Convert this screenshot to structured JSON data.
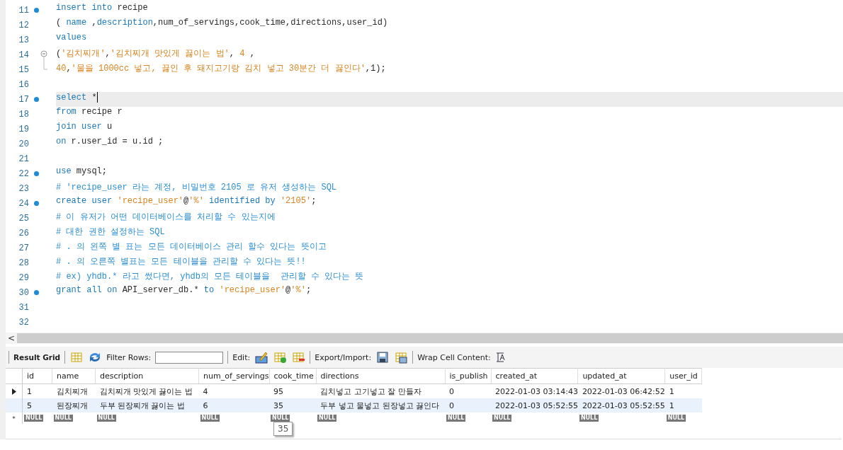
{
  "editor": {
    "lines": [
      {
        "number": "11",
        "statement_start": true,
        "current": false,
        "fold_start": false,
        "fold_end": false,
        "tokens": [
          {
            "kind": "kw",
            "text": "insert"
          },
          {
            "kind": "kw",
            "text": " into"
          },
          {
            "kind": "plain",
            "text": " recipe"
          }
        ]
      },
      {
        "number": "12",
        "statement_start": false,
        "current": false,
        "fold_start": false,
        "fold_end": false,
        "tokens": [
          {
            "kind": "plain",
            "text": "( "
          },
          {
            "kind": "kw",
            "text": "name"
          },
          {
            "kind": "plain",
            "text": " ,"
          },
          {
            "kind": "kw",
            "text": "description"
          },
          {
            "kind": "plain",
            "text": ",num_of_servings,cook_time,directions,user_id)"
          }
        ]
      },
      {
        "number": "13",
        "statement_start": false,
        "current": false,
        "fold_start": false,
        "fold_end": false,
        "tokens": [
          {
            "kind": "kw",
            "text": "values"
          }
        ]
      },
      {
        "number": "14",
        "statement_start": false,
        "current": false,
        "fold_start": true,
        "fold_end": false,
        "tokens": [
          {
            "kind": "plain",
            "text": "("
          },
          {
            "kind": "str",
            "text": "'김치찌개'"
          },
          {
            "kind": "plain",
            "text": ","
          },
          {
            "kind": "str",
            "text": "'김치찌개 맛있게 끓이는 법'"
          },
          {
            "kind": "plain",
            "text": ", "
          },
          {
            "kind": "str",
            "text": "4"
          },
          {
            "kind": "plain",
            "text": " ,"
          }
        ]
      },
      {
        "number": "15",
        "statement_start": false,
        "current": false,
        "fold_start": false,
        "fold_end": true,
        "tokens": [
          {
            "kind": "str",
            "text": "40"
          },
          {
            "kind": "plain",
            "text": ","
          },
          {
            "kind": "str",
            "text": "'물을 1000cc 넣고, 끓인 후 돼지고기랑 김치 넣고 30분간 더 끓인다'"
          },
          {
            "kind": "plain",
            "text": ",1);"
          }
        ]
      },
      {
        "number": "16",
        "statement_start": false,
        "current": false,
        "fold_start": false,
        "fold_end": false
      },
      {
        "number": "17",
        "statement_start": true,
        "current": true,
        "fold_start": false,
        "fold_end": false,
        "tokens": [
          {
            "kind": "kw",
            "text": "select"
          },
          {
            "kind": "plain",
            "text": " *"
          }
        ]
      },
      {
        "number": "18",
        "statement_start": false,
        "current": false,
        "fold_start": false,
        "fold_end": false,
        "tokens": [
          {
            "kind": "kw",
            "text": "from"
          },
          {
            "kind": "plain",
            "text": " recipe r"
          }
        ]
      },
      {
        "number": "19",
        "statement_start": false,
        "current": false,
        "fold_start": false,
        "fold_end": false,
        "tokens": [
          {
            "kind": "kw",
            "text": "join"
          },
          {
            "kind": "kw",
            "text": " user"
          },
          {
            "kind": "plain",
            "text": " u"
          }
        ]
      },
      {
        "number": "20",
        "statement_start": false,
        "current": false,
        "fold_start": false,
        "fold_end": false,
        "tokens": [
          {
            "kind": "kw",
            "text": "on"
          },
          {
            "kind": "plain",
            "text": " r.user_id = u.id ;"
          }
        ]
      },
      {
        "number": "21",
        "statement_start": false,
        "current": false,
        "fold_start": false,
        "fold_end": false
      },
      {
        "number": "22",
        "statement_start": true,
        "current": false,
        "fold_start": false,
        "fold_end": false,
        "tokens": [
          {
            "kind": "kw",
            "text": "use"
          },
          {
            "kind": "plain",
            "text": " mysql;"
          }
        ]
      },
      {
        "number": "23",
        "statement_start": false,
        "current": false,
        "fold_start": false,
        "fold_end": false,
        "tokens": [
          {
            "kind": "comment",
            "text": "# 'recipe_user 라는 계정, 비밀번호 2105 로 유저 생성하는 SQL"
          }
        ]
      },
      {
        "number": "24",
        "statement_start": true,
        "current": false,
        "fold_start": false,
        "fold_end": false,
        "tokens": [
          {
            "kind": "kw",
            "text": "create"
          },
          {
            "kind": "kw",
            "text": " user"
          },
          {
            "kind": "str",
            "text": " 'recipe_user'"
          },
          {
            "kind": "plain",
            "text": "@"
          },
          {
            "kind": "str",
            "text": "'%'"
          },
          {
            "kind": "kw",
            "text": " identified"
          },
          {
            "kind": "kw",
            "text": " by"
          },
          {
            "kind": "str",
            "text": " '2105'"
          },
          {
            "kind": "plain",
            "text": ";"
          }
        ]
      },
      {
        "number": "25",
        "statement_start": false,
        "current": false,
        "fold_start": false,
        "fold_end": false,
        "tokens": [
          {
            "kind": "comment",
            "text": "# 이 유저가 어떤 데이터베이스를 처리할 수 있는지에"
          }
        ]
      },
      {
        "number": "26",
        "statement_start": false,
        "current": false,
        "fold_start": false,
        "fold_end": false,
        "tokens": [
          {
            "kind": "comment",
            "text": "# 대한 권한 설정하는 SQL"
          }
        ]
      },
      {
        "number": "27",
        "statement_start": false,
        "current": false,
        "fold_start": false,
        "fold_end": false,
        "tokens": [
          {
            "kind": "comment",
            "text": "# . 의 왼쪽 별 표는 모든 데이터베이스 관리 할수 있다는 뜻이고"
          }
        ]
      },
      {
        "number": "28",
        "statement_start": false,
        "current": false,
        "fold_start": false,
        "fold_end": false,
        "tokens": [
          {
            "kind": "comment",
            "text": "# . 의 오른쪽 별표는 모든 테이블을 관리할 수 있다는 뜻!!"
          }
        ]
      },
      {
        "number": "29",
        "statement_start": false,
        "current": false,
        "fold_start": false,
        "fold_end": false,
        "tokens": [
          {
            "kind": "comment",
            "text": "# ex) yhdb.* 라고 썼다면, yhdb의 모든 테이블을  관리할 수 있다는 뜻"
          }
        ]
      },
      {
        "number": "30",
        "statement_start": true,
        "current": false,
        "fold_start": false,
        "fold_end": false,
        "tokens": [
          {
            "kind": "kw",
            "text": "grant"
          },
          {
            "kind": "kw",
            "text": " all"
          },
          {
            "kind": "kw",
            "text": " on"
          },
          {
            "kind": "plain",
            "text": " API_server_db.* "
          },
          {
            "kind": "kw",
            "text": "to"
          },
          {
            "kind": "str",
            "text": " 'recipe_user'"
          },
          {
            "kind": "plain",
            "text": "@"
          },
          {
            "kind": "str",
            "text": "'%'"
          },
          {
            "kind": "plain",
            "text": ";"
          }
        ]
      },
      {
        "number": "31",
        "statement_start": false,
        "current": false,
        "fold_start": false,
        "fold_end": false
      },
      {
        "number": "32",
        "statement_start": false,
        "current": false,
        "fold_start": false,
        "fold_end": false
      }
    ]
  },
  "scrollbar": {
    "arrow": "<"
  },
  "toolbar": {
    "result_grid": "Result Grid",
    "filter_label": "Filter Rows:",
    "edit_label": "Edit:",
    "export_label": "Export/Import:",
    "wrap_label": "Wrap Cell Content:"
  },
  "grid": {
    "columns": [
      "id",
      "name",
      "description",
      "num_of_servings",
      "cook_time",
      "directions",
      "is_publish",
      "created_at",
      "updated_at",
      "user_id"
    ],
    "rows": [
      {
        "current": true,
        "hovered": false,
        "cells": [
          "1",
          "김치찌개",
          "김치찌개 맛있게 끓이는 법",
          "4",
          "95",
          "김치넣고 고기넣고 잘 만들자",
          "0",
          "2022-01-03 03:14:43",
          "2022-01-03 06:42:52",
          "1"
        ]
      },
      {
        "current": false,
        "hovered": true,
        "cells": [
          "5",
          "된장찌개",
          "두부 된장찌개 끓이는 법",
          "6",
          "35",
          "두부 넣고 물넣고 된장넣고 끓인다",
          "0",
          "2022-01-03 05:52:55",
          "2022-01-03 05:52:55",
          "1"
        ]
      }
    ],
    "new_row": {
      "marker": "*",
      "cells": [
        "NULL",
        "NULL",
        "NULL",
        "NULL",
        "NULL",
        "NULL",
        "NULL",
        "NULL",
        "NULL",
        "NULL"
      ]
    },
    "tooltip": {
      "text": "35"
    }
  }
}
